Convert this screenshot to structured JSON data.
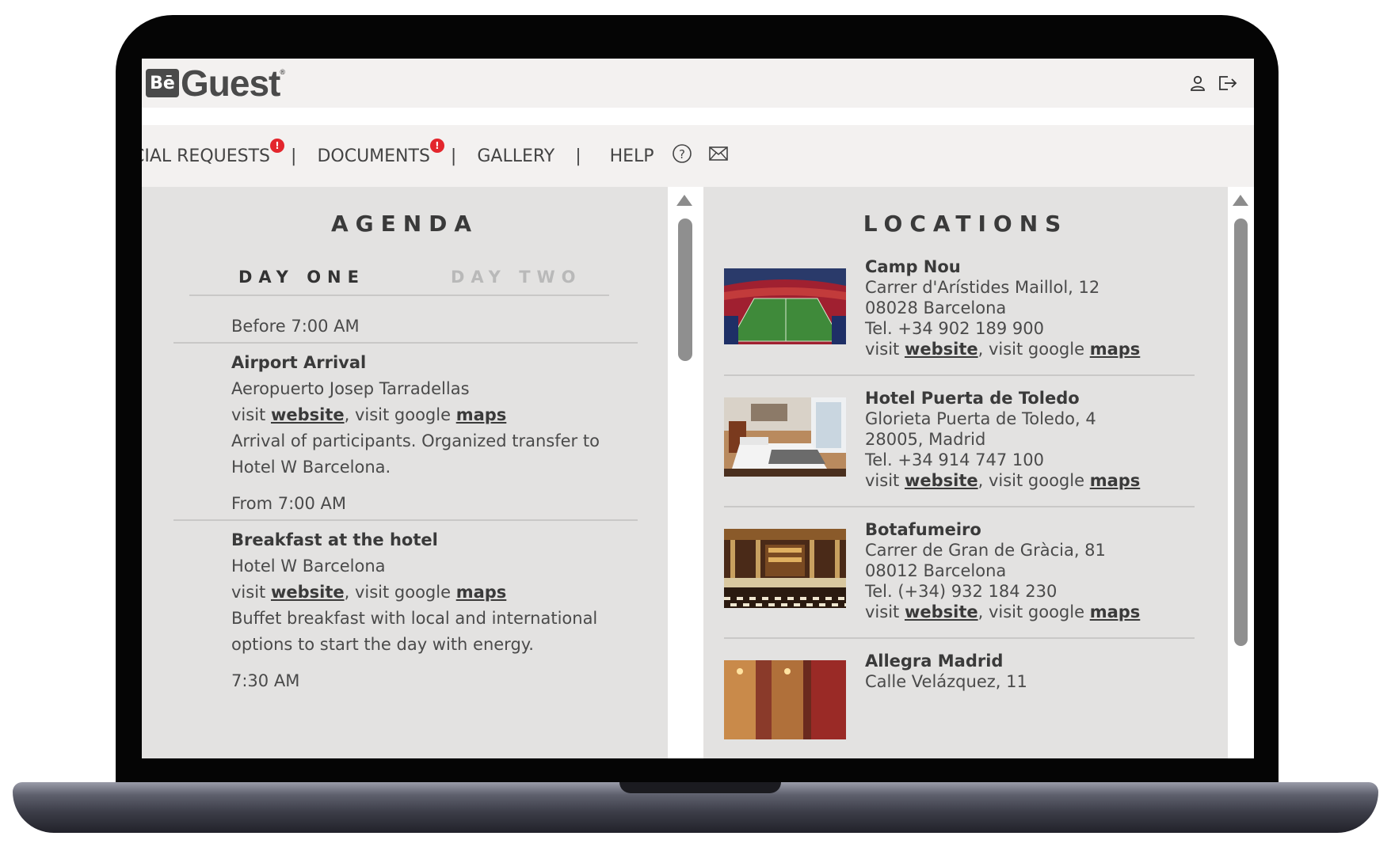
{
  "app": {
    "logo_badge": "Bē",
    "logo_text": "Guest",
    "logo_reg": "®"
  },
  "header_icons": [
    "user-icon",
    "logout-icon"
  ],
  "nav": {
    "special_requests": "CIAL REQUESTS",
    "documents": "DOCUMENTS",
    "gallery": "GALLERY",
    "help": "HELP",
    "badge_text": "!",
    "separator": "|"
  },
  "agenda": {
    "title": "AGENDA",
    "tabs": [
      {
        "label": "DAY ONE",
        "active": true
      },
      {
        "label": "DAY TWO",
        "active": false
      }
    ],
    "visit_prefix": "visit ",
    "website_label": "website",
    "maps_prefix": ", visit google ",
    "maps_label": "maps",
    "items": [
      {
        "time": "Before 7:00 AM",
        "title": "Airport Arrival",
        "location": "Aeropuerto Josep Tarradellas",
        "description": "Arrival of participants. Organized transfer to Hotel W Barcelona."
      },
      {
        "time": "From 7:00 AM",
        "title": "Breakfast at the hotel",
        "location": "Hotel W Barcelona",
        "description": "Buffet breakfast with local and international options to start the day with energy."
      },
      {
        "time": "7:30 AM"
      }
    ]
  },
  "locations": {
    "title": "LOCATIONS",
    "visit_prefix": "visit ",
    "website_label": "website",
    "maps_prefix": ", visit google ",
    "maps_label": "maps",
    "items": [
      {
        "name": "Camp Nou",
        "address1": "Carrer d'Arístides Maillol, 12",
        "address2": "08028 Barcelona",
        "phone": "Tel. +34 902 189 900"
      },
      {
        "name": "Hotel Puerta de Toledo",
        "address1": "Glorieta Puerta de Toledo, 4",
        "address2": "28005, Madrid",
        "phone": "Tel. +34 914 747 100"
      },
      {
        "name": "Botafumeiro",
        "address1": "Carrer de Gran de Gràcia, 81",
        "address2": "08012 Barcelona",
        "phone": "Tel. (+34) 932 184 230"
      },
      {
        "name": "Allegra Madrid",
        "address1": "Calle Velázquez, 11"
      }
    ]
  },
  "colors": {
    "panel_bg": "#e3e2e1",
    "header_bg": "#f3f1f0",
    "badge_red": "#e3262d",
    "text": "#4a4a4a"
  }
}
